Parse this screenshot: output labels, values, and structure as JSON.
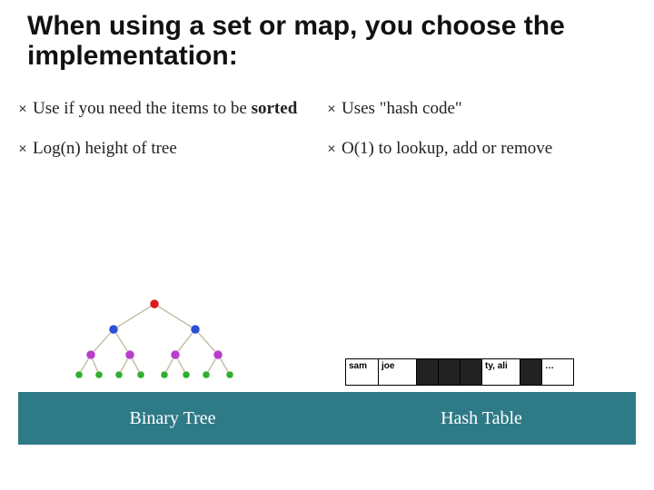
{
  "title": "When using a set or map, you choose the implementation:",
  "left": {
    "b1_pre": "Use if you need the items to be ",
    "b1_bold": "sorted",
    "b2": "Log(n) height of tree"
  },
  "right": {
    "b1": "Uses \"hash code\"",
    "b2": "O(1) to lookup, add or remove"
  },
  "hash": {
    "c0": "sam",
    "c1": "joe",
    "c5": "ty, ali",
    "c7": "…"
  },
  "labels": {
    "left": "Binary Tree",
    "right": "Hash Table"
  }
}
